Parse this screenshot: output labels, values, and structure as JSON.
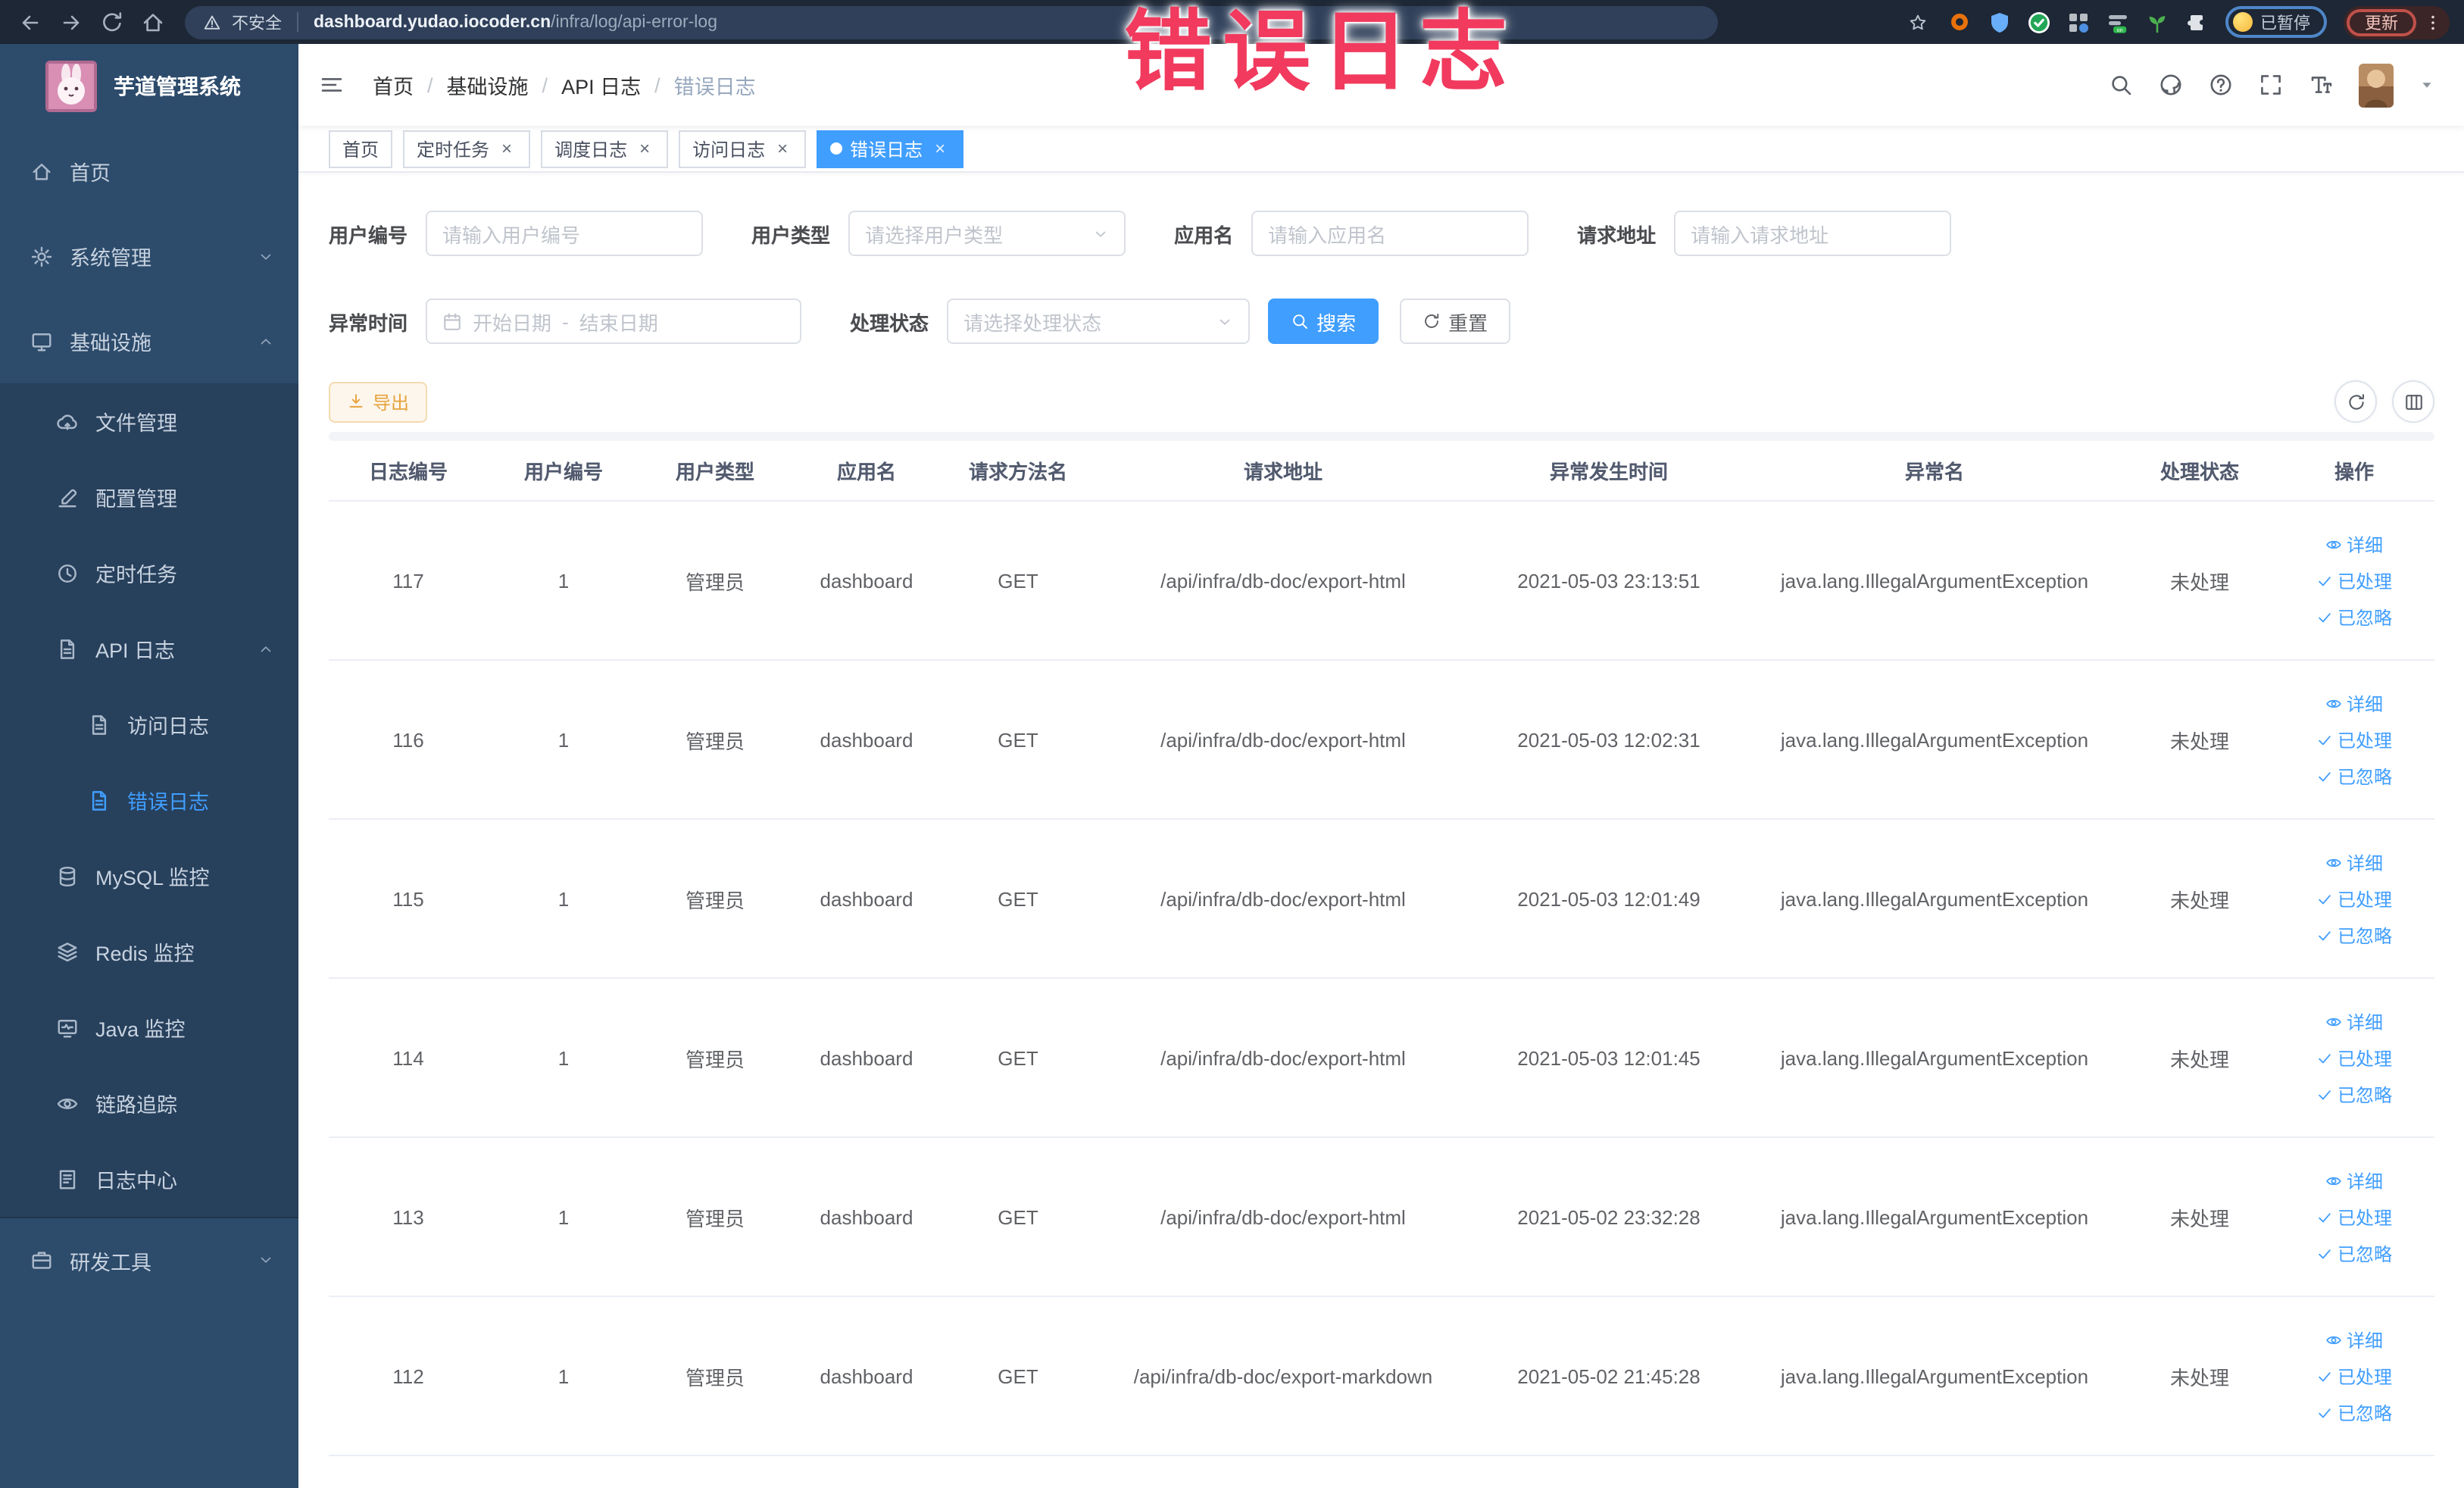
{
  "annotation": {
    "text": "错误日志",
    "color": "#f13a5e"
  },
  "browser": {
    "nav_icons": [
      {
        "name": "arrow-left-icon"
      },
      {
        "name": "arrow-right-icon"
      },
      {
        "name": "reload-icon"
      },
      {
        "name": "home-icon"
      }
    ],
    "warning_icon": "warning-icon",
    "security_label": "不安全",
    "url_host": "dashboard.yudao.iocoder.cn",
    "url_path": "/infra/log/api-error-log",
    "star_icon": "star-icon",
    "extensions": [
      {
        "name": "extension-ring-icon",
        "style": "ring",
        "color": "#e8710a"
      },
      {
        "name": "extension-shield-icon",
        "style": "shield",
        "color": "#69aef8"
      },
      {
        "name": "extension-check-badge-icon",
        "style": "badge-check",
        "color": "#21a657"
      },
      {
        "name": "extension-grid-icon",
        "style": "grid-dot",
        "color": "#b8bdc4"
      },
      {
        "name": "extension-on-switch-icon",
        "style": "bars-on",
        "color": "#2db84d"
      },
      {
        "name": "extension-sprout-icon",
        "style": "sprout",
        "color": "#4caf50"
      },
      {
        "name": "extension-puzzle-icon",
        "style": "puzzle",
        "color": "#dfe3e8"
      }
    ],
    "paused_face_icon": "smiley-icon",
    "paused_label": "已暂停",
    "update_label": "更新",
    "menu_icon": "dots-vertical-icon"
  },
  "sidebar": {
    "title": "芋道管理系统",
    "logo_icon": "rabbit-logo",
    "menu": [
      {
        "key": "home",
        "label": "首页",
        "icon": "home-icon",
        "level": 1
      },
      {
        "key": "system",
        "label": "系统管理",
        "icon": "gear-icon",
        "level": 1,
        "chevron": "down"
      },
      {
        "key": "infra",
        "label": "基础设施",
        "icon": "monitor-icon",
        "level": 1,
        "chevron": "up"
      },
      {
        "key": "file",
        "label": "文件管理",
        "icon": "cloud-icon",
        "level": 2,
        "in_submenu": true
      },
      {
        "key": "config",
        "label": "配置管理",
        "icon": "edit-icon",
        "level": 2,
        "in_submenu": true
      },
      {
        "key": "job",
        "label": "定时任务",
        "icon": "clock-icon",
        "level": 2,
        "in_submenu": true
      },
      {
        "key": "api-log",
        "label": "API 日志",
        "icon": "doc-icon",
        "level": 2,
        "in_submenu": true,
        "chevron": "up"
      },
      {
        "key": "access-log",
        "label": "访问日志",
        "icon": "doc-icon",
        "level": 3,
        "in_submenu": true
      },
      {
        "key": "error-log",
        "label": "错误日志",
        "icon": "doc-icon",
        "level": 3,
        "in_submenu": true,
        "active": true
      },
      {
        "key": "mysql",
        "label": "MySQL 监控",
        "icon": "database-icon",
        "level": 2,
        "in_submenu": true
      },
      {
        "key": "redis",
        "label": "Redis 监控",
        "icon": "layers-icon",
        "level": 2,
        "in_submenu": true
      },
      {
        "key": "java",
        "label": "Java 监控",
        "icon": "screen-icon",
        "level": 2,
        "in_submenu": true
      },
      {
        "key": "trace",
        "label": "链路追踪",
        "icon": "eye-icon",
        "level": 2,
        "in_submenu": true
      },
      {
        "key": "log-center",
        "label": "日志中心",
        "icon": "log-icon",
        "level": 2,
        "in_submenu": true
      },
      {
        "key": "dev-tools",
        "label": "研发工具",
        "icon": "briefcase-icon",
        "level": 1,
        "chevron": "down",
        "divider_top": true
      }
    ]
  },
  "header": {
    "collapse_icon": "hamburger-icon",
    "breadcrumb": [
      "首页",
      "基础设施",
      "API 日志",
      "错误日志"
    ],
    "right_icons": [
      {
        "name": "search-icon"
      },
      {
        "name": "github-icon"
      },
      {
        "name": "question-icon"
      },
      {
        "name": "fullscreen-icon"
      },
      {
        "name": "font-size-icon"
      }
    ],
    "avatar": "user-avatar",
    "caret_icon": "caret-down-icon"
  },
  "tabs": [
    {
      "label": "首页",
      "closable": false,
      "active": false
    },
    {
      "label": "定时任务",
      "closable": true,
      "active": false
    },
    {
      "label": "调度日志",
      "closable": true,
      "active": false
    },
    {
      "label": "访问日志",
      "closable": true,
      "active": false
    },
    {
      "label": "错误日志",
      "closable": true,
      "active": true
    }
  ],
  "filters": {
    "row1": [
      {
        "label": "用户编号",
        "control": "input",
        "placeholder": "请输入用户编号"
      },
      {
        "label": "用户类型",
        "control": "select",
        "placeholder": "请选择用户类型"
      },
      {
        "label": "应用名",
        "control": "input",
        "placeholder": "请输入应用名"
      },
      {
        "label": "请求地址",
        "control": "input",
        "placeholder": "请输入请求地址"
      }
    ],
    "row2": {
      "time_label": "异常时间",
      "calendar_icon": "calendar-icon",
      "start_placeholder": "开始日期",
      "range_separator": "-",
      "end_placeholder": "结束日期",
      "status_label": "处理状态",
      "status_placeholder": "请选择处理状态",
      "status_caret_icon": "chevron-down-icon"
    }
  },
  "buttons": {
    "search": "搜索",
    "search_icon": "search-icon",
    "reset": "重置",
    "reset_icon": "refresh-icon"
  },
  "toolbar": {
    "export_label": "导出",
    "export_icon": "download-icon",
    "right_buttons": [
      {
        "name": "refresh-button",
        "icon": "refresh-icon"
      },
      {
        "name": "columns-button",
        "icon": "grid-icon"
      }
    ]
  },
  "table": {
    "columns": [
      "日志编号",
      "用户编号",
      "用户类型",
      "应用名",
      "请求方法名",
      "请求地址",
      "异常发生时间",
      "异常名",
      "处理状态",
      "操作"
    ],
    "row_actions": [
      {
        "label": "详细",
        "icon": "eye-icon"
      },
      {
        "label": "已处理",
        "icon": "check-icon"
      },
      {
        "label": "已忽略",
        "icon": "check-icon"
      }
    ],
    "rows": [
      {
        "id": "117",
        "user_id": "1",
        "user_type": "管理员",
        "app_name": "dashboard",
        "method": "GET",
        "url": "/api/infra/db-doc/export-html",
        "time": "2021-05-03 23:13:51",
        "exception": "java.lang.IllegalArgumentException",
        "status": "未处理"
      },
      {
        "id": "116",
        "user_id": "1",
        "user_type": "管理员",
        "app_name": "dashboard",
        "method": "GET",
        "url": "/api/infra/db-doc/export-html",
        "time": "2021-05-03 12:02:31",
        "exception": "java.lang.IllegalArgumentException",
        "status": "未处理"
      },
      {
        "id": "115",
        "user_id": "1",
        "user_type": "管理员",
        "app_name": "dashboard",
        "method": "GET",
        "url": "/api/infra/db-doc/export-html",
        "time": "2021-05-03 12:01:49",
        "exception": "java.lang.IllegalArgumentException",
        "status": "未处理"
      },
      {
        "id": "114",
        "user_id": "1",
        "user_type": "管理员",
        "app_name": "dashboard",
        "method": "GET",
        "url": "/api/infra/db-doc/export-html",
        "time": "2021-05-03 12:01:45",
        "exception": "java.lang.IllegalArgumentException",
        "status": "未处理"
      },
      {
        "id": "113",
        "user_id": "1",
        "user_type": "管理员",
        "app_name": "dashboard",
        "method": "GET",
        "url": "/api/infra/db-doc/export-html",
        "time": "2021-05-02 23:32:28",
        "exception": "java.lang.IllegalArgumentException",
        "status": "未处理"
      },
      {
        "id": "112",
        "user_id": "1",
        "user_type": "管理员",
        "app_name": "dashboard",
        "method": "GET",
        "url": "/api/infra/db-doc/export-markdown",
        "time": "2021-05-02 21:45:28",
        "exception": "java.lang.IllegalArgumentException",
        "status": "未处理"
      }
    ]
  },
  "colors": {
    "accent_blue": "#409eff",
    "sidebar_bg": "#2d4b6b",
    "sidebar_submenu_bg": "#27405c",
    "browser_bar_bg": "#1d2735",
    "export_orange": "#e6a23c",
    "annotation_red": "#f13a5e"
  }
}
